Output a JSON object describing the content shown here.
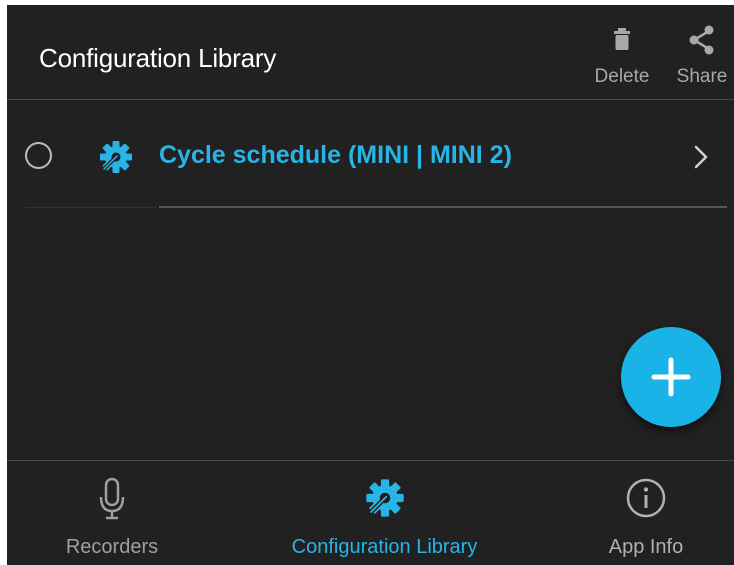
{
  "header": {
    "title": "Configuration Library",
    "actions": [
      {
        "label": "Delete",
        "icon": "trash-icon"
      },
      {
        "label": "Share",
        "icon": "share-icon"
      }
    ]
  },
  "list": {
    "items": [
      {
        "label": "Cycle schedule (MINI | MINI 2)",
        "icon": "gear-wrench-icon",
        "selected": false
      }
    ]
  },
  "fab": {
    "icon": "plus-icon"
  },
  "bottom_nav": {
    "items": [
      {
        "label": "Recorders",
        "icon": "microphone-icon",
        "active": false
      },
      {
        "label": "Configuration Library",
        "icon": "gear-wrench-icon",
        "active": true
      },
      {
        "label": "App Info",
        "icon": "info-icon",
        "active": false
      }
    ]
  },
  "colors": {
    "background": "#212121",
    "accent": "#28b4e6",
    "fab": "#1ab3e8",
    "text_primary": "#ffffff",
    "text_secondary": "#a8a8a8"
  }
}
